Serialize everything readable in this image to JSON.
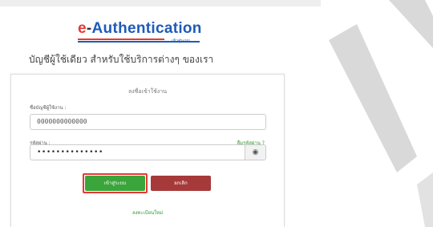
{
  "logo": {
    "e": "e",
    "dash": "-",
    "auth": "Authentication",
    "tagline": "เข้าสู่ระบบ"
  },
  "subtitle": "บัญชีผู้ใช้เดียว สำหรับใช้บริการต่างๆ ของเรา",
  "card": {
    "title": "ลงชื่อเข้าใช้งาน",
    "username_label": "ชื่อบัญชีผู้ใช้งาน :",
    "username_value": "0000000000000",
    "password_label": "รหัสผ่าน :",
    "password_value": "••••••••••••••",
    "forgot_link": "ลืมรหัสผ่าน ?",
    "eye_icon": "◉",
    "login_label": "เข้าสู่ระบบ",
    "cancel_label": "ยกเลิก",
    "register_link": "ลงทะเบียนใหม่"
  },
  "colors": {
    "brand_red": "#e53935",
    "brand_blue": "#1e5bb8",
    "login_green": "#3aa53a",
    "cancel_red": "#a63a3a"
  }
}
